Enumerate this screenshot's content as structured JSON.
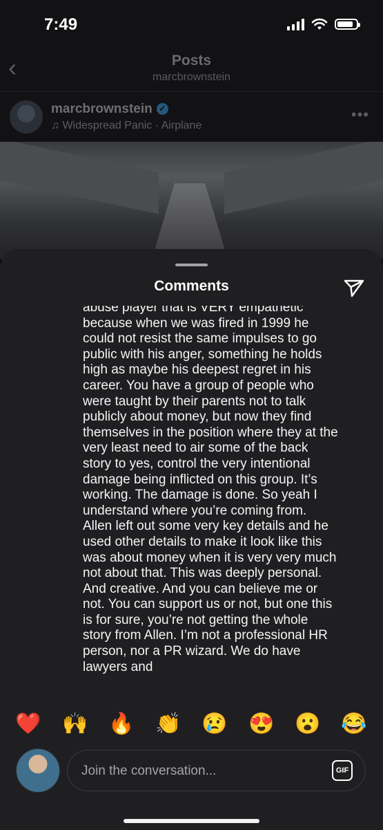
{
  "status_bar": {
    "time": "7:49"
  },
  "header": {
    "title": "Posts",
    "subtitle": "marcbrownstein"
  },
  "post": {
    "username": "marcbrownstein",
    "song": "Widespread Panic · Airplane"
  },
  "comments_sheet": {
    "title": "Comments",
    "comment_text": "abuse player that is VERY empathetic because when we was fired in 1999 he could not resist the same impulses to go public with his anger, something he holds high as maybe his deepest regret in his career. You have a group of people who were taught by their parents not to talk publicly about money, but now they find themselves in the position where they at the very least need to air some of the back story to yes, control the very intentional damage being inflicted on this group. It’s working. The damage is done. So yeah I understand where you’re coming from. Allen left out some very key details and he used other details to make it look like this was about money when it is very very much not about that. This was deeply personal. And creative. And you can believe me or not. You can support us or not, but one this is for sure, you’re not getting the whole story from Allen. I’m not a professional HR person, nor a PR wizard. We do have lawyers and"
  },
  "reactions": [
    "❤️",
    "🙌",
    "🔥",
    "👏",
    "😢",
    "😍",
    "😮",
    "😂"
  ],
  "composer": {
    "placeholder": "Join the conversation...",
    "gif_label": "GIF"
  }
}
